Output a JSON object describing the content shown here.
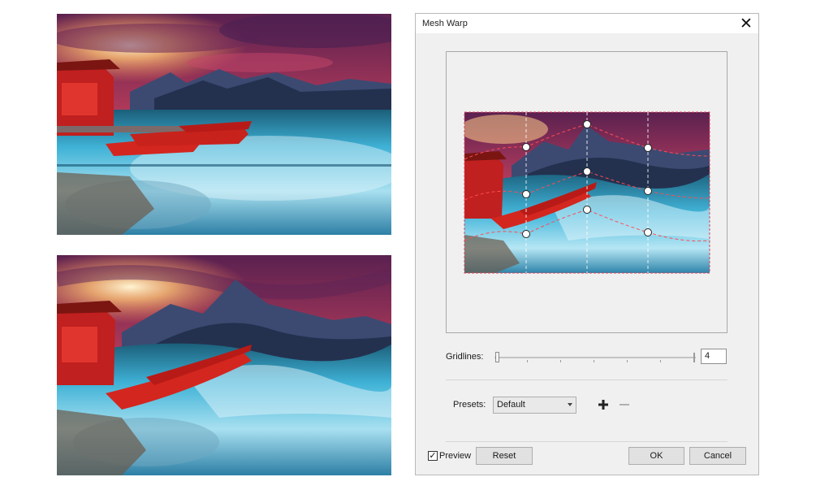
{
  "images": {
    "original": {
      "icon": "landscape-photo"
    },
    "warped": {
      "icon": "landscape-photo-warped"
    }
  },
  "dialog": {
    "title": "Mesh Warp",
    "close_icon": "close-icon",
    "gridlines": {
      "label": "Gridlines:",
      "value": "4",
      "slider_fraction": 0.0
    },
    "presets": {
      "label": "Presets:",
      "selected": "Default",
      "add_icon": "plus-icon",
      "remove_icon": "minus-icon"
    },
    "preview": {
      "label": "Preview",
      "checked": true,
      "check_mark": "✓"
    },
    "buttons": {
      "reset": "Reset",
      "ok": "OK",
      "cancel": "Cancel"
    }
  },
  "colors": {
    "dialog_bg": "#f0f0f0",
    "mesh_line": "#ff3b3b",
    "node_fill": "#ffffff",
    "sky_dark": "#4a1f52",
    "sky_glow": "#ff9a4a",
    "water": "#3fb2d6",
    "boat": "#d3261f"
  }
}
